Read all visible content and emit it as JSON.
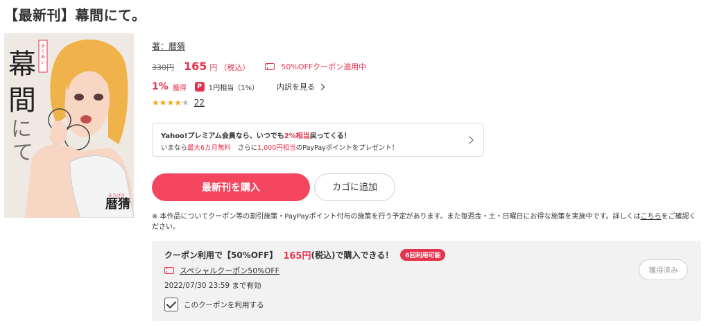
{
  "title": "【最新刊】幕間にて。",
  "cover": {
    "title_text": "幕間にて",
    "furigana": "まくあいにて",
    "author_seal": "暦猜",
    "author_furigana": "そうげき"
  },
  "author": {
    "label": "著：暦猜"
  },
  "price": {
    "original": "330円",
    "current": "165",
    "yen": "円",
    "tax": "（税込）",
    "coupon_applied": "50%OFFクーポン適用中"
  },
  "points": {
    "percent": "1%",
    "label": "獲得",
    "paypay_icon_text": "P",
    "yen_equiv": "1円相当（1%）",
    "breakdown": "内訳を見る"
  },
  "rating": {
    "stars": 4.5,
    "count": "22"
  },
  "promo": {
    "line1_a": "Yahoo!プレミアム会員なら、いつでも",
    "line1_red": "2%相当",
    "line1_b": "戻ってくる！",
    "line2_a": "いまなら",
    "line2_red1": "最大6カ月無料",
    "line2_b": "　さらに",
    "line2_red2": "1,000円相当",
    "line2_c": "のPayPayポイントをプレゼント！"
  },
  "buttons": {
    "buy": "最新刊を購入",
    "cart": "カゴに追加"
  },
  "note": {
    "text": "※ 本作品についてクーポン等の割引施策・PayPayポイント付与の施策を行う予定があります。また毎週金・土・日曜日にお得な施策を実施中です。詳しくは",
    "link": "こちら",
    "suffix": "をご確認ください。"
  },
  "coupon": {
    "line_a": "クーポン利用で【50%OFF】",
    "line_price": "165円",
    "line_b": "(税込)で購入できる！",
    "badge": "6回利用可能",
    "name": "スペシャルクーポン50%OFF",
    "expiry": "2022/07/30 23:59 まで有効",
    "use_label": "このクーポンを利用する",
    "acquired": "獲得済み"
  },
  "colors": {
    "accent": "#e6334d",
    "button": "#f4455e"
  }
}
